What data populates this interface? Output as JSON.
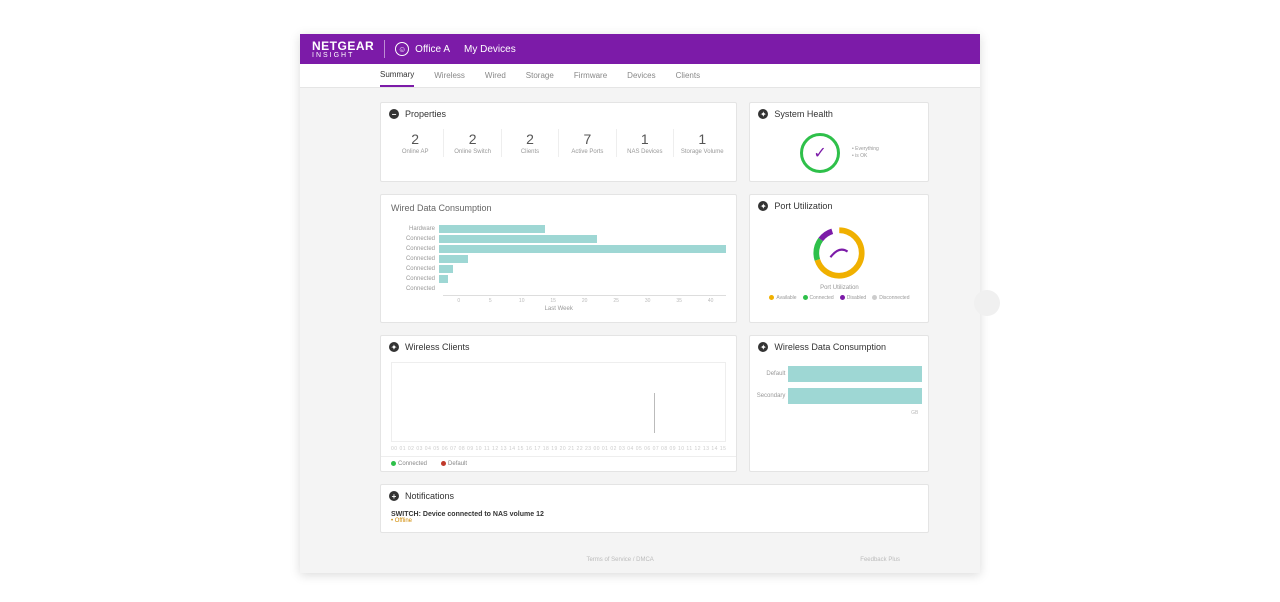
{
  "brand": {
    "name": "NETGEAR",
    "sub": "INSIGHT"
  },
  "header": {
    "location": "Office A",
    "link": "My Devices"
  },
  "tabs": [
    "Summary",
    "Wireless",
    "Wired",
    "Storage",
    "Firmware",
    "Devices",
    "Clients"
  ],
  "properties": {
    "title": "Properties",
    "items": [
      {
        "value": "2",
        "label": "Online AP"
      },
      {
        "value": "2",
        "label": "Online Switch"
      },
      {
        "value": "2",
        "label": "Clients"
      },
      {
        "value": "7",
        "label": "Active Ports"
      },
      {
        "value": "1",
        "label": "NAS Devices"
      },
      {
        "value": "1",
        "label": "Storage Volume"
      }
    ]
  },
  "wired": {
    "title": "Wired Data Consumption",
    "xlabel": "Last Week",
    "categories": [
      "Hardware",
      "Connected",
      "Connected",
      "Connected",
      "Connected",
      "Connected",
      "Connected"
    ],
    "ticks": [
      "0",
      "5",
      "10",
      "15",
      "20",
      "25",
      "30",
      "35",
      "40"
    ]
  },
  "health": {
    "title": "System Health",
    "legend": [
      "Everything",
      "is OK"
    ]
  },
  "port": {
    "title": "Port Utilization",
    "sub": "Port Utilization",
    "legend": [
      "Available",
      "Connected",
      "Disabled",
      "Disconnected"
    ]
  },
  "wclients": {
    "title": "Wireless Clients",
    "legend": [
      "Connected",
      "Default"
    ]
  },
  "wdc": {
    "title": "Wireless Data Consumption",
    "rows": [
      {
        "label": "Default",
        "pct": 100
      },
      {
        "label": "Secondary",
        "pct": 100
      }
    ],
    "xcap": "GB"
  },
  "notif": {
    "title": "Notifications",
    "line": "SWITCH: Device connected to NAS volume 12",
    "sub": "• Offline"
  },
  "footer": {
    "center": "Terms of Service / DMCA",
    "right": "Feedback Plus"
  },
  "chart_data": [
    {
      "type": "bar",
      "title": "Wired Data Consumption",
      "orientation": "horizontal",
      "categories": [
        "Hardware",
        "Connected",
        "Connected",
        "Connected",
        "Connected",
        "Connected",
        "Connected"
      ],
      "values": [
        15,
        22,
        40,
        4,
        2,
        1,
        0
      ],
      "xlabel": "Last Week",
      "xlim": [
        0,
        40
      ]
    },
    {
      "type": "pie",
      "title": "Port Utilization",
      "series": [
        {
          "name": "Available",
          "value": 70
        },
        {
          "name": "Connected",
          "value": 15
        },
        {
          "name": "Disabled",
          "value": 10
        },
        {
          "name": "Disconnected",
          "value": 5
        }
      ]
    },
    {
      "type": "bar",
      "title": "Wireless Data Consumption",
      "orientation": "horizontal",
      "categories": [
        "Default",
        "Secondary"
      ],
      "values": [
        1.0,
        1.0
      ],
      "xlabel": "GB"
    },
    {
      "type": "line",
      "title": "Wireless Clients",
      "series": [
        {
          "name": "Connected",
          "values": []
        },
        {
          "name": "Default",
          "values": []
        }
      ]
    }
  ]
}
